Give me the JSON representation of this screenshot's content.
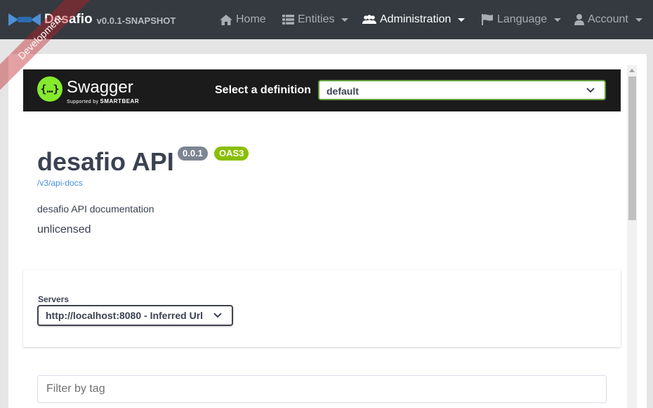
{
  "navbar": {
    "brand_name": "Desafio",
    "brand_version": "v0.0.1-SNAPSHOT",
    "ribbon": "Development",
    "items": [
      {
        "label": "Home",
        "icon": "home-icon",
        "dropdown": false,
        "active": false
      },
      {
        "label": "Entities",
        "icon": "list-icon",
        "dropdown": true,
        "active": false
      },
      {
        "label": "Administration",
        "icon": "users-cog-icon",
        "dropdown": true,
        "active": true
      },
      {
        "label": "Language",
        "icon": "flag-icon",
        "dropdown": true,
        "active": false
      },
      {
        "label": "Account",
        "icon": "user-icon",
        "dropdown": true,
        "active": false
      }
    ]
  },
  "swagger": {
    "title": "Swagger",
    "subtitle_prefix": "Supported by",
    "subtitle_brand": "SMARTBEAR",
    "logo_glyph": "{…}",
    "definition_label": "Select a definition",
    "definition_value": "default"
  },
  "api": {
    "title": "desafio API",
    "version_badge": "0.0.1",
    "oas_badge": "OAS3",
    "docs_link": "/v3/api-docs",
    "description": "desafio API documentation",
    "license": "unlicensed"
  },
  "servers": {
    "label": "Servers",
    "selected": "http://localhost:8080 - Inferred Url"
  },
  "filter": {
    "placeholder": "Filter by tag"
  },
  "colors": {
    "navbar_bg": "#343a40",
    "swagger_green": "#85ea2d",
    "oas_badge": "#89bf04",
    "version_badge": "#7d8492",
    "link": "#4990e2"
  }
}
